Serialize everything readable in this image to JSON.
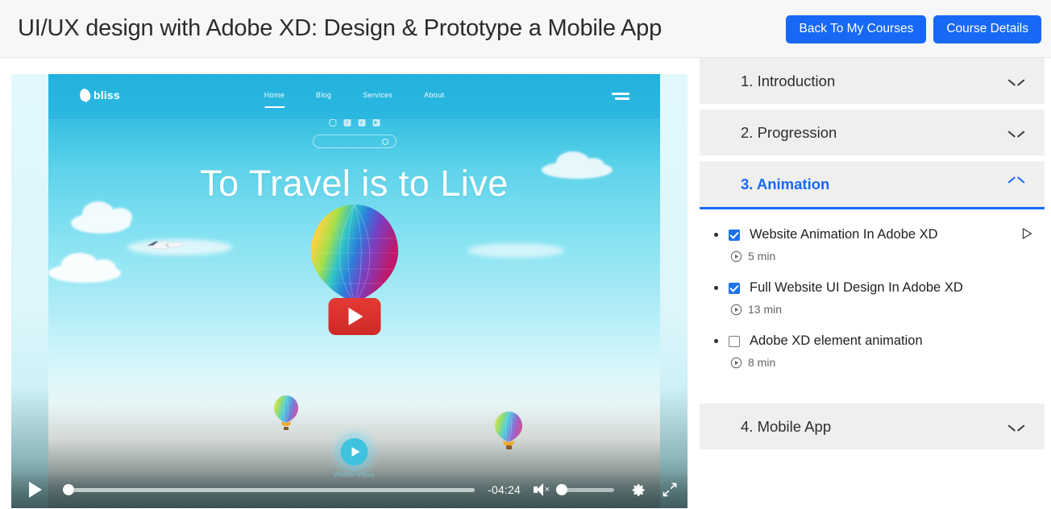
{
  "header": {
    "title": "UI/UX design with Adobe XD: Design & Prototype a Mobile App",
    "buttons": [
      {
        "label": "Back To My Courses",
        "name": "back-to-my-courses-button"
      },
      {
        "label": "Course Details",
        "name": "course-details-button"
      }
    ],
    "accent_color": "#1769f5",
    "background_color": "#f6f7f8"
  },
  "player": {
    "play_icon": "play-icon",
    "time_remaining": "-04:24",
    "progress_percent": 0,
    "volume_percent": 0,
    "muted": true,
    "mute_icon": "volume-muted-icon",
    "settings_icon": "gear-icon",
    "fullscreen_icon": "fullscreen-icon",
    "center_play_icon": "youtube-play-icon",
    "video_content": {
      "brand": "bliss",
      "nav": [
        "Home",
        "Blog",
        "Services",
        "About"
      ],
      "active_nav": "Home",
      "socials": [
        "instagram-icon",
        "facebook-icon",
        "twitter-icon",
        "youtube-icon"
      ],
      "hero_title": "To Travel is to Live",
      "watch_label": "Watch Video",
      "menu_icon": "hamburger-menu-icon",
      "search_icon": "search-icon"
    }
  },
  "sidebar": {
    "sections": [
      {
        "title": "1. Introduction",
        "open": false,
        "chevron": "chevron-down-icon"
      },
      {
        "title": "2. Progression",
        "open": false,
        "chevron": "chevron-down-icon"
      },
      {
        "title": "3. Animation",
        "open": true,
        "chevron": "chevron-up-icon"
      },
      {
        "title": "4. Mobile App",
        "open": false,
        "chevron": "chevron-down-icon"
      }
    ],
    "lessons": [
      {
        "title": "Website Animation In Adobe XD",
        "duration": "5 min",
        "checked": true,
        "has_play": true,
        "duration_icon": "circle-play-icon"
      },
      {
        "title": "Full Website UI Design In Adobe XD",
        "duration": "13 min",
        "checked": true,
        "has_play": false,
        "duration_icon": "circle-play-icon"
      },
      {
        "title": "Adobe XD element animation",
        "duration": "8 min",
        "checked": false,
        "has_play": false,
        "duration_icon": "circle-play-icon"
      }
    ],
    "active_color": "#1769f5",
    "header_bg": "#efefef"
  }
}
